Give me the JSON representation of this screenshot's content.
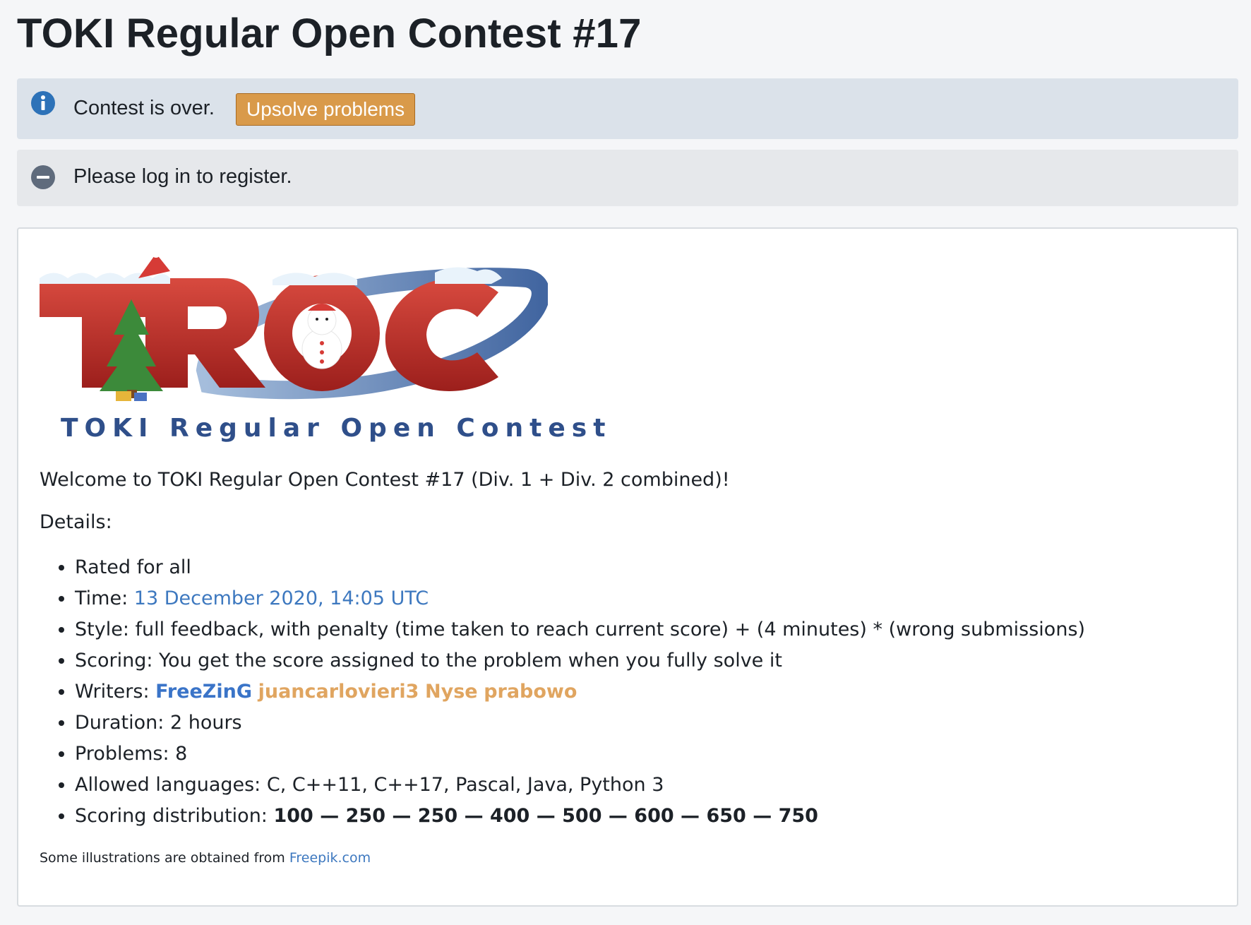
{
  "page": {
    "title": "TOKI Regular Open Contest #17"
  },
  "status": {
    "info_icon": "info-icon",
    "contest_over_text": "Contest is over.",
    "upsolve_label": "Upsolve problems",
    "register_icon": "minus-circle-icon",
    "register_text": "Please log in to register."
  },
  "logo": {
    "wordmark": "TROC",
    "caption": "TOKI Regular Open Contest"
  },
  "description": {
    "welcome": "Welcome to TOKI Regular Open Contest #17 (Div. 1 + Div. 2 combined)!",
    "details_label": "Details:",
    "rated_text": "Rated for all",
    "time_label": "Time: ",
    "time_value": "13 December 2020, 14:05 UTC",
    "style_text": "Style: full feedback, with penalty (time taken to reach current score) + (4 minutes) * (wrong submissions)",
    "scoring_text": "Scoring: You get the score assigned to the problem when you fully solve it",
    "writers_label": "Writers: ",
    "writers": [
      "FreeZinG",
      "juancarlovieri3",
      "Nyse",
      "prabowo"
    ],
    "duration_text": "Duration: 2 hours",
    "problems_text": "Problems: 8",
    "languages_text": "Allowed languages: C, C++11, C++17, Pascal, Java, Python 3",
    "distribution_label": "Scoring distribution: ",
    "distribution_value": "100 — 250 — 250 — 400 — 500 — 600 — 650 — 750",
    "footer_prefix": "Some illustrations are obtained from ",
    "footer_link": "Freepik.com"
  },
  "colors": {
    "info_bg": "#dbe2ea",
    "upsolve_bg": "#d99a4a",
    "link_blue": "#3d78bf",
    "writer_orange": "#e0a560",
    "logo_red": "#c8302c",
    "logo_navy": "#2f4f8a"
  }
}
